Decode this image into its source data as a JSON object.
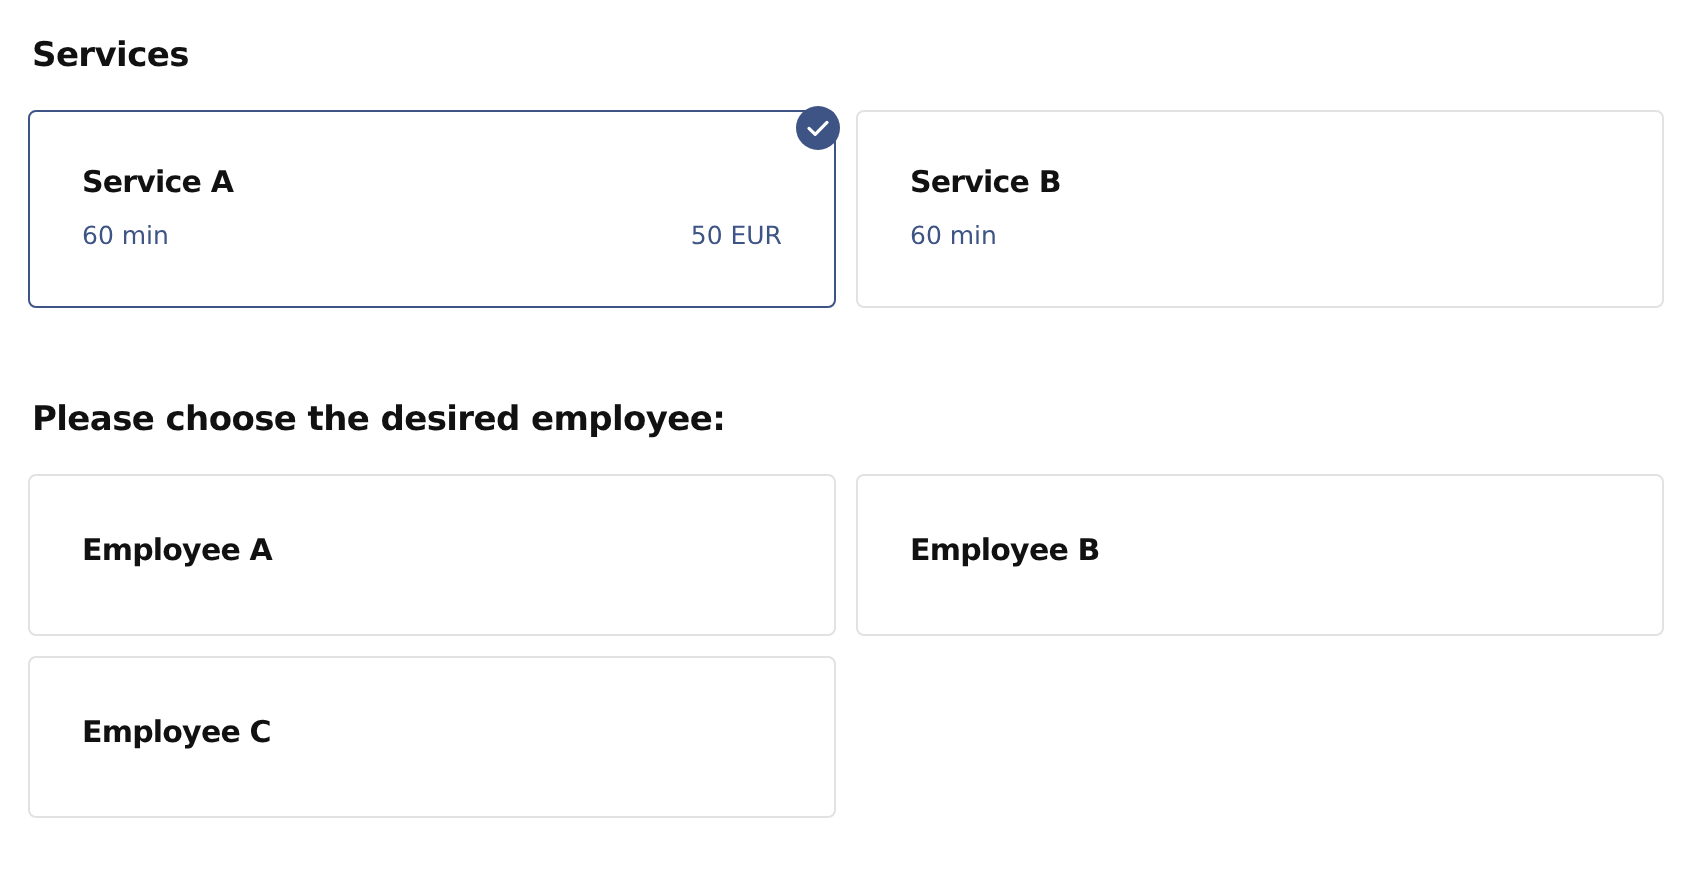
{
  "services": {
    "title": "Services",
    "items": [
      {
        "name": "Service A",
        "duration": "60 min",
        "price": "50 EUR",
        "selected": true
      },
      {
        "name": "Service B",
        "duration": "60 min",
        "selected": false
      }
    ]
  },
  "employees": {
    "title": "Please choose the desired employee:",
    "items": [
      {
        "name": "Employee A",
        "selected": false
      },
      {
        "name": "Employee B",
        "selected": false
      },
      {
        "name": "Employee C",
        "selected": false
      }
    ]
  }
}
